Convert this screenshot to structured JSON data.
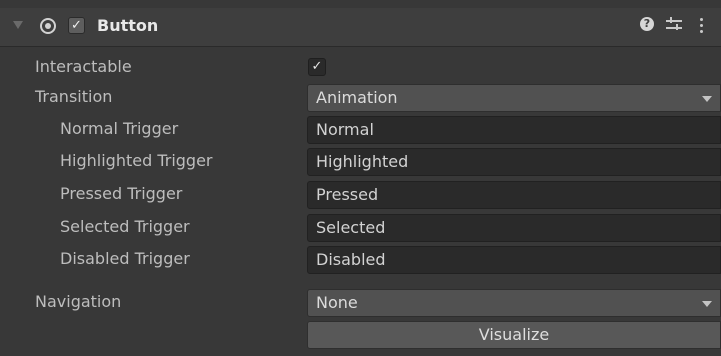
{
  "header": {
    "title": "Button",
    "enabled_check": "✓",
    "help_glyph": "?",
    "icons": [
      "foldout-triangle-icon",
      "component-icon",
      "help-icon",
      "presets-icon",
      "context-menu-icon"
    ]
  },
  "fields": {
    "interactable": {
      "label": "Interactable",
      "checked_glyph": "✓"
    },
    "transition": {
      "label": "Transition",
      "value": "Animation"
    },
    "normal_trigger": {
      "label": "Normal Trigger",
      "value": "Normal"
    },
    "highlighted_trigger": {
      "label": "Highlighted Trigger",
      "value": "Highlighted"
    },
    "pressed_trigger": {
      "label": "Pressed Trigger",
      "value": "Pressed"
    },
    "selected_trigger": {
      "label": "Selected Trigger",
      "value": "Selected"
    },
    "disabled_trigger": {
      "label": "Disabled Trigger",
      "value": "Disabled"
    },
    "navigation": {
      "label": "Navigation",
      "value": "None"
    }
  },
  "visualize_label": "Visualize",
  "colors": {
    "background": "#383838",
    "header": "#3e3e3e",
    "field": "#2a2a2a",
    "dropdown": "#515151",
    "text": "#c4c4c4"
  }
}
